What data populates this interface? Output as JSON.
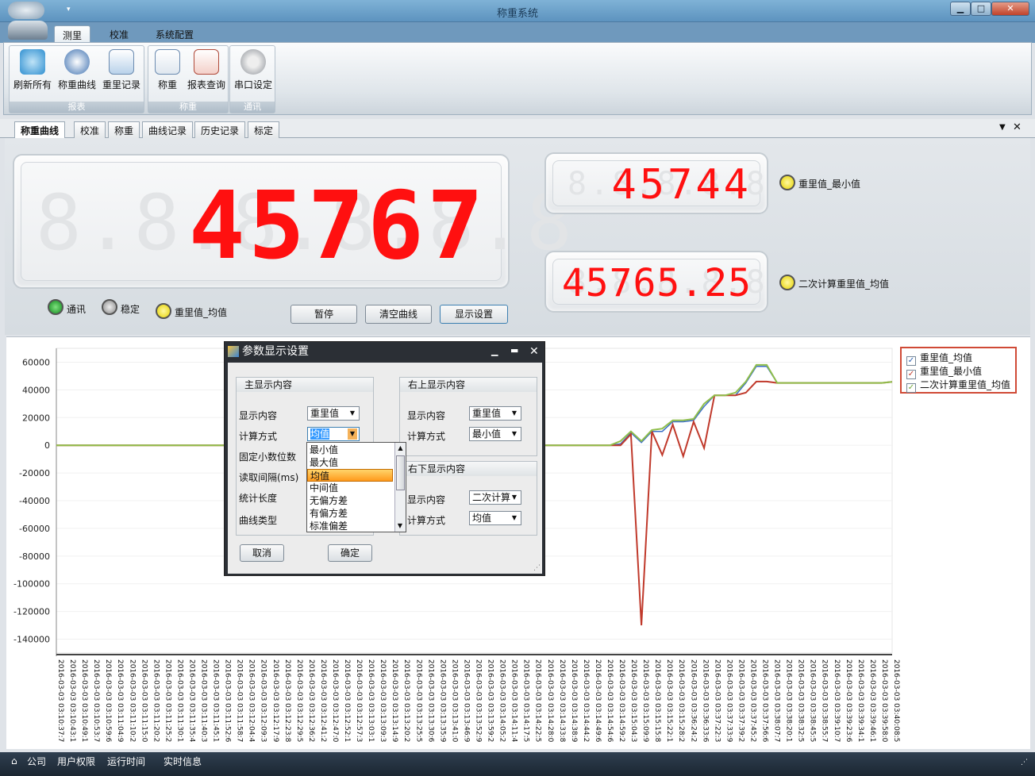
{
  "window": {
    "title": "称重系统",
    "min": "▁",
    "max": "□",
    "close": "✕"
  },
  "ribbon": {
    "tabs": [
      "测里",
      "校准",
      "系统配置"
    ],
    "groups": [
      {
        "label": "报表",
        "buttons": [
          "刷新所有",
          "称重曲线",
          "重里记录"
        ]
      },
      {
        "label": "称重",
        "buttons": [
          "称重",
          "报表查询"
        ]
      },
      {
        "label": "通讯",
        "buttons": [
          "串口设定"
        ]
      }
    ]
  },
  "doc_tabs": [
    "称重曲线",
    "校准",
    "称重",
    "曲线记录",
    "历史记录",
    "标定"
  ],
  "displays": {
    "main": {
      "value": "45767",
      "ghost": "8.8.8.8.8.8"
    },
    "top_right": {
      "value": "45744",
      "ghost": "8.8.8.8.8",
      "label": "重里值_最小值"
    },
    "bottom_right": {
      "value": "45765.25",
      "ghost": "8.8.8.8.8",
      "label": "二次计算重里值_均值"
    }
  },
  "status_leds": [
    {
      "label": "通讯",
      "color": "#1fa52f"
    },
    {
      "label": "稳定",
      "color": "#9a9a9a"
    },
    {
      "label": "重里值_均值",
      "color": "#f2e20f"
    }
  ],
  "buttons": {
    "pause": "暂停",
    "clear": "清空曲线",
    "display": "显示设置"
  },
  "chart_data": {
    "type": "line",
    "ylim": [
      -150000,
      70000
    ],
    "yticks": [
      "60000",
      "40000",
      "20000",
      "0",
      "-20000",
      "-40000",
      "-60000",
      "-80000",
      "-100000",
      "-120000",
      "-140000"
    ],
    "yticks_values": [
      60000,
      40000,
      20000,
      0,
      -20000,
      -40000,
      -60000,
      -80000,
      -100000,
      -120000,
      -140000
    ],
    "xlabels": [
      "2016-03-03 03:10:37:7",
      "2016-03-03 03:10:43:1",
      "2016-03-03 03:10:49:1",
      "2016-03-03 03:10:53:7",
      "2016-03-03 03:10:59:6",
      "2016-03-03 03:11:04:9",
      "2016-03-03 03:11:10:2",
      "2016-03-03 03:11:15:0",
      "2016-03-03 03:11:20:2",
      "2016-03-03 03:11:25:2",
      "2016-03-03 03:11:30:1",
      "2016-03-03 03:11:35:4",
      "2016-03-03 03:11:40:3",
      "2016-03-03 03:11:45:1",
      "2016-03-03 03:11:52:6",
      "2016-03-03 03:11:58:7",
      "2016-03-03 03:12:04:4",
      "2016-03-03 03:12:09:3",
      "2016-03-03 03:12:17:9",
      "2016-03-03 03:12:23:8",
      "2016-03-03 03:12:29:5",
      "2016-03-03 03:12:36:2",
      "2016-03-03 03:12:41:2",
      "2016-03-03 03:12:47:0",
      "2016-03-03 03:12:52:1",
      "2016-03-03 03:12:57:3",
      "2016-03-03 03:13:03:1",
      "2016-03-03 03:13:09:3",
      "2016-03-03 03:13:14:9",
      "2016-03-03 03:13:20:2",
      "2016-03-03 03:13:25:5",
      "2016-03-03 03:13:30:6",
      "2016-03-03 03:13:35:9",
      "2016-03-03 03:13:41:0",
      "2016-03-03 03:13:46:9",
      "2016-03-03 03:13:52:9",
      "2016-03-03 03:13:59:2",
      "2016-03-03 03:14:05:2",
      "2016-03-03 03:14:11:4",
      "2016-03-03 03:14:17:5",
      "2016-03-03 03:14:22:5",
      "2016-03-03 03:14:28:0",
      "2016-03-03 03:14:33:8",
      "2016-03-03 03:14:38:9",
      "2016-03-03 03:14:44:2",
      "2016-03-03 03:14:49:6",
      "2016-03-03 03:14:54:6",
      "2016-03-03 03:14:59:2",
      "2016-03-03 03:15:04:3",
      "2016-03-03 03:15:09:9",
      "2016-03-03 03:15:15:8",
      "2016-03-03 03:15:22:1",
      "2016-03-03 03:15:28:2",
      "2016-03-03 03:36:24:2",
      "2016-03-03 03:36:33:6",
      "2016-03-03 03:37:22:3",
      "2016-03-03 03:37:33:9",
      "2016-03-03 03:37:39:2",
      "2016-03-03 03:37:45:2",
      "2016-03-03 03:37:56:6",
      "2016-03-03 03:38:07:7",
      "2016-03-03 03:38:20:1",
      "2016-03-03 03:38:32:5",
      "2016-03-03 03:38:45:5",
      "2016-03-03 03:38:55:7",
      "2016-03-03 03:39:10:7",
      "2016-03-03 03:39:23:6",
      "2016-03-03 03:39:34:1",
      "2016-03-03 03:39:46:1",
      "2016-03-03 03:39:58:0",
      "2016-03-03 03:40:08:5"
    ],
    "series": [
      {
        "name": "重里值_均值",
        "color": "#3b6fc7",
        "values": [
          0,
          0,
          0,
          0,
          0,
          0,
          0,
          0,
          0,
          0,
          0,
          0,
          0,
          0,
          0,
          0,
          0,
          0,
          0,
          0,
          0,
          0,
          0,
          0,
          0,
          0,
          0,
          0,
          0,
          0,
          0,
          0,
          0,
          0,
          0,
          0,
          0,
          0,
          0,
          0,
          0,
          0,
          0,
          0,
          0,
          0,
          0,
          0,
          0,
          0,
          0,
          0,
          0,
          0,
          1000,
          9000,
          2000,
          10000,
          10000,
          17000,
          17000,
          18000,
          28000,
          36000,
          36000,
          36000,
          45000,
          57000,
          57000,
          45000,
          45000,
          45000,
          45000,
          45000,
          45000,
          45000,
          45000,
          45000,
          45000,
          45000,
          45767
        ]
      },
      {
        "name": "重里值_最小值",
        "color": "#c0392b",
        "values": [
          0,
          0,
          0,
          0,
          0,
          0,
          0,
          0,
          0,
          0,
          0,
          0,
          0,
          0,
          0,
          0,
          0,
          0,
          0,
          0,
          0,
          0,
          0,
          0,
          0,
          0,
          0,
          0,
          0,
          0,
          0,
          0,
          0,
          0,
          0,
          0,
          0,
          0,
          0,
          0,
          0,
          0,
          0,
          0,
          0,
          0,
          0,
          0,
          0,
          0,
          0,
          0,
          0,
          0,
          0,
          8000,
          -130000,
          10000,
          -7000,
          15000,
          -8000,
          17000,
          -2000,
          36000,
          36000,
          36000,
          38000,
          46000,
          46000,
          45000,
          45000,
          45000,
          45000,
          45000,
          45000,
          45000,
          45000,
          45000,
          45000,
          45000,
          45744
        ]
      },
      {
        "name": "二次计算重里值_均值",
        "color": "#8fbe4b",
        "values": [
          0,
          0,
          0,
          0,
          0,
          0,
          0,
          0,
          0,
          0,
          0,
          0,
          0,
          0,
          0,
          0,
          0,
          0,
          0,
          0,
          0,
          0,
          0,
          0,
          0,
          0,
          0,
          0,
          0,
          0,
          0,
          0,
          0,
          0,
          0,
          0,
          0,
          0,
          0,
          0,
          0,
          0,
          0,
          0,
          0,
          0,
          0,
          0,
          0,
          0,
          0,
          0,
          0,
          0,
          3000,
          10000,
          3000,
          11000,
          12000,
          18000,
          18000,
          19000,
          30000,
          36000,
          36000,
          38000,
          46000,
          58000,
          58000,
          45000,
          45000,
          45000,
          45000,
          45000,
          45000,
          45000,
          45000,
          45000,
          45000,
          45000,
          45765
        ]
      }
    ]
  },
  "legend": [
    "重里值_均值",
    "重里值_最小值",
    "二次计算重里值_均值"
  ],
  "dialog": {
    "title": "参数显示设置",
    "main_group": {
      "title": "主显示内容",
      "rows": [
        {
          "label": "显示内容",
          "value": "重里值"
        },
        {
          "label": "计算方式",
          "value": "均值"
        },
        {
          "label": "固定小数位数",
          "value": ""
        },
        {
          "label": "读取间隔(ms)",
          "value": ""
        },
        {
          "label": "统计长度",
          "value": ""
        },
        {
          "label": "曲线类型",
          "value": ""
        }
      ]
    },
    "tr_group": {
      "title": "右上显示内容",
      "rows": [
        {
          "label": "显示内容",
          "value": "重里值"
        },
        {
          "label": "计算方式",
          "value": "最小值"
        }
      ]
    },
    "br_group": {
      "title": "右下显示内容",
      "rows": [
        {
          "label": "显示内容",
          "value": "二次计算"
        },
        {
          "label": "计算方式",
          "value": "均值"
        }
      ]
    },
    "dropdown_options": [
      "最小值",
      "最大值",
      "均值",
      "中间值",
      "无偏方差",
      "有偏方差",
      "标准偏差"
    ],
    "dropdown_selected": "均值",
    "cancel": "取消",
    "ok": "确定"
  },
  "statusbar": [
    "公司",
    "用户权限",
    "运行时间",
    "实时信息"
  ]
}
